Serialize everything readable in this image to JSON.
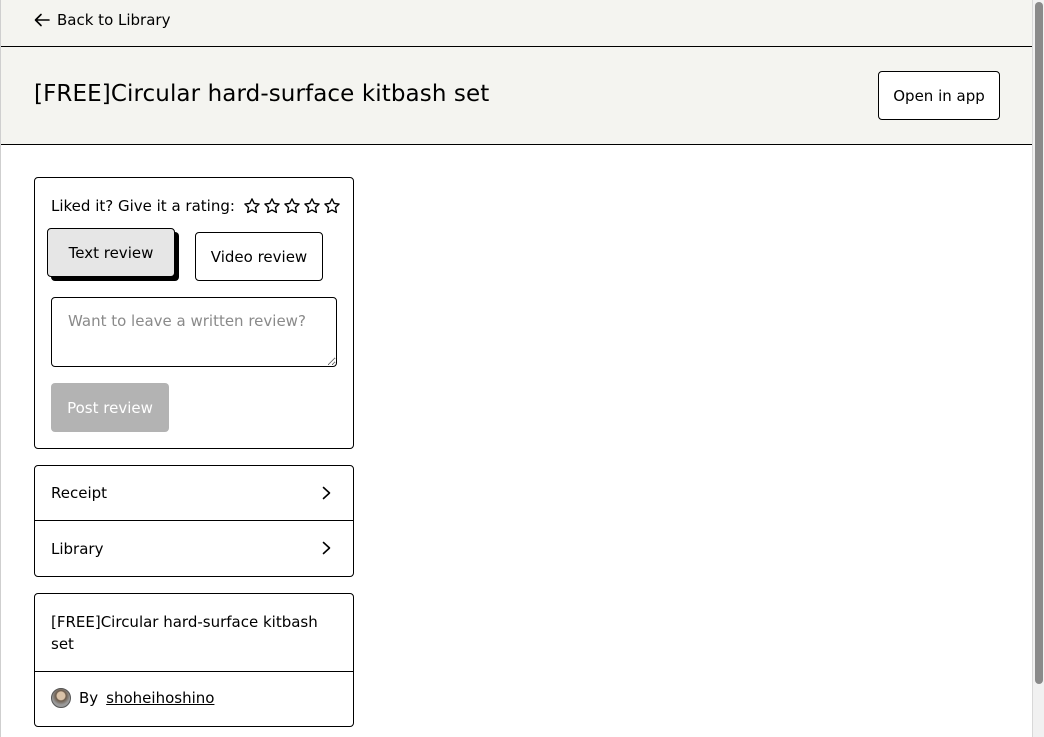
{
  "nav": {
    "back_label": "Back to Library"
  },
  "header": {
    "title": "[FREE]Circular hard-surface kitbash set",
    "open_in_app_label": "Open in app"
  },
  "review": {
    "prompt": "Liked it? Give it a rating:",
    "star_count": 5,
    "rating": 0,
    "tabs": [
      {
        "label": "Text review",
        "selected": true
      },
      {
        "label": "Video review",
        "selected": false
      }
    ],
    "input_placeholder": "Want to leave a written review?",
    "input_value": "",
    "post_label": "Post review"
  },
  "links": [
    {
      "label": "Receipt"
    },
    {
      "label": "Library"
    }
  ],
  "product": {
    "name": "[FREE]Circular hard-surface kitbash set",
    "by_label": "By",
    "author": "shoheihoshino"
  },
  "colors": {
    "header_bg": "#f4f4f0",
    "selected_tab_bg": "#e6e6e6",
    "disabled_button_bg": "#b3b3b3",
    "placeholder_text": "#8a8a8a"
  },
  "icons": {
    "back": "arrow-left-icon",
    "star": "star-outline-icon",
    "chevron": "chevron-right-icon",
    "avatar": "avatar"
  }
}
